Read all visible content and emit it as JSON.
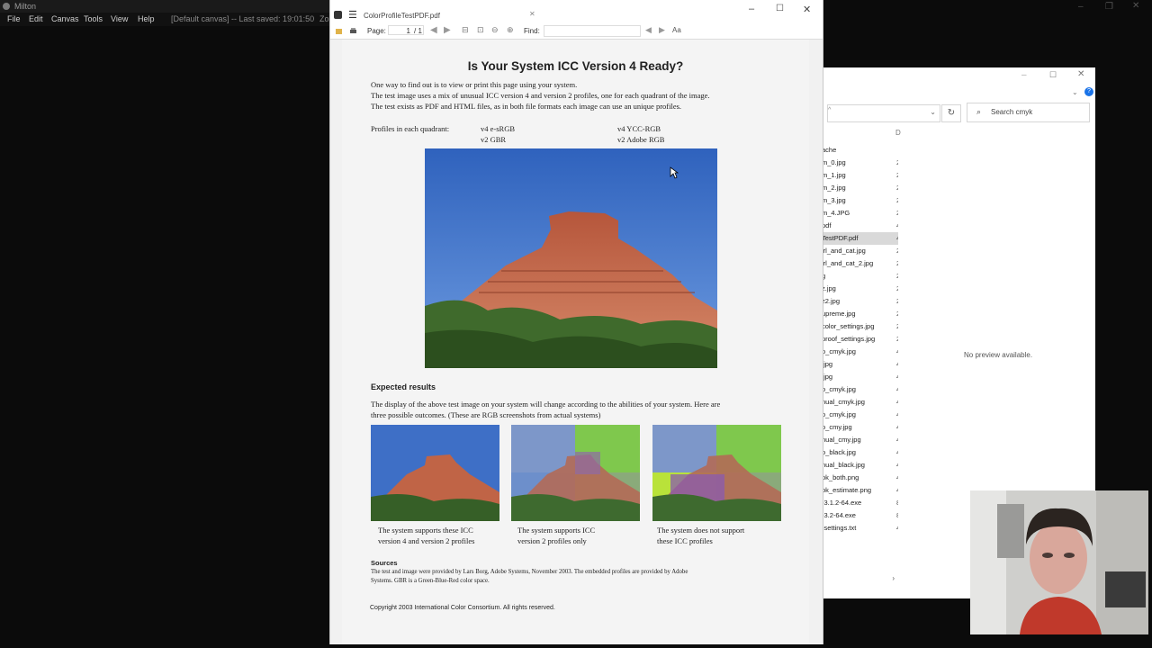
{
  "milton": {
    "title": "Milton",
    "menu": [
      "File",
      "Edit",
      "Canvas",
      "Tools",
      "View",
      "Help"
    ],
    "status": "[Default canvas] -- Last saved: 19:01:50",
    "zoom_label": "Zo"
  },
  "pdf_viewer": {
    "tab_title": "ColorProfileTestPDF.pdf",
    "page_label": "Page:",
    "page_value": "1",
    "page_total": "/ 1",
    "find_label": "Find:",
    "find_value": ""
  },
  "document": {
    "heading": "Is Your System ICC Version 4 Ready?",
    "intro": [
      "One way to find out is to view or print this page using your system.",
      "The test image uses a mix of unusual ICC version 4 and version 2 profiles, one for each quadrant of the image.",
      "The test exists as PDF and HTML files, as in both file formats each image can use an unique profiles."
    ],
    "profiles_label": "Profiles in each quadrant:",
    "profiles": [
      "v4 e-sRGB",
      "v2 GBR",
      "v4 YCC-RGB",
      "v2 Adobe RGB"
    ],
    "expected_heading": "Expected results",
    "expected_text": [
      "The display of the above test image on your system will change according to the abilities of your system. Here are",
      "three possible outcomes. (These are RGB screenshots from actual systems)"
    ],
    "captions": [
      [
        "The system supports these ICC",
        "version 4 and version 2 profiles"
      ],
      [
        "The system supports ICC",
        "version 2 profiles only"
      ],
      [
        "The system does not support",
        "these ICC profiles"
      ]
    ],
    "sources_heading": "Sources",
    "sources_text": [
      "The test and image were provided by Lars Borg, Adobe Systems, November 2003. The embedded profiles are provided by Adobe",
      "Systems.  GBR is a Green-Blue-Red color space."
    ],
    "copyright": "Copyright 2003 International Color Consortium. All rights reserved."
  },
  "explorer": {
    "search_placeholder": "Search cmyk",
    "preview_text": "No preview available.",
    "column_header": "D",
    "files": [
      {
        "name": "ache",
        "meta": ""
      },
      {
        "name": "m_0.jpg",
        "meta": "2"
      },
      {
        "name": "m_1.jpg",
        "meta": "2"
      },
      {
        "name": "m_2.jpg",
        "meta": "2"
      },
      {
        "name": "m_3.jpg",
        "meta": "2"
      },
      {
        "name": "m_4.JPG",
        "meta": "2"
      },
      {
        "name": "pdf",
        "meta": "4"
      },
      {
        "name": "TestPDF.pdf",
        "meta": "4"
      },
      {
        "name": "irl_and_cat.jpg",
        "meta": "2"
      },
      {
        "name": "irl_and_cat_2.jpg",
        "meta": "2"
      },
      {
        "name": "g",
        "meta": "2"
      },
      {
        "name": "z.jpg",
        "meta": "2"
      },
      {
        "name": "z2.jpg",
        "meta": "2"
      },
      {
        "name": "upreme.jpg",
        "meta": "2"
      },
      {
        "name": "color_settings.jpg",
        "meta": "2"
      },
      {
        "name": "proof_settings.jpg",
        "meta": "2"
      },
      {
        "name": "o_cmyk.jpg",
        "meta": "4"
      },
      {
        "name": ".jpg",
        "meta": "4"
      },
      {
        "name": ".jpg",
        "meta": "4"
      },
      {
        "name": "o_cmyk.jpg",
        "meta": "4"
      },
      {
        "name": "nual_cmyk.jpg",
        "meta": "4"
      },
      {
        "name": "o_cmyk.jpg",
        "meta": "4"
      },
      {
        "name": "o_cmy.jpg",
        "meta": "4"
      },
      {
        "name": "nual_cmy.jpg",
        "meta": "4"
      },
      {
        "name": "o_black.jpg",
        "meta": "4"
      },
      {
        "name": "nual_black.jpg",
        "meta": "4"
      },
      {
        "name": "ok_both.png",
        "meta": "4"
      },
      {
        "name": "ok_estimate.png",
        "meta": "4"
      },
      {
        "name": "-3.1.2-64.exe",
        "meta": "8"
      },
      {
        "name": "-3.2-64.exe",
        "meta": "8"
      },
      {
        "name": "-settings.txt",
        "meta": "4"
      }
    ],
    "selected_index": 7
  },
  "colors": {
    "sky": "#3f73c8",
    "rock": "#b5573a",
    "accent_blue": "#1a73e8"
  }
}
